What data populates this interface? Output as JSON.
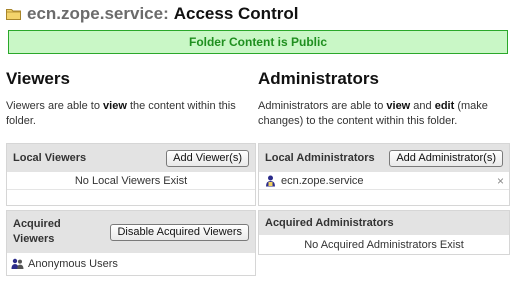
{
  "page": {
    "title_context": "ecn.zope.service:",
    "title_main": "Access Control",
    "status_banner": "Folder Content is Public"
  },
  "viewers": {
    "heading": "Viewers",
    "desc_pre": "Viewers are able to ",
    "desc_bold": "view",
    "desc_post": " the content within this folder.",
    "local_label": "Local Viewers",
    "add_button": "Add Viewer(s)",
    "local_empty": "No Local Viewers Exist",
    "acquired_label": "Acquired Viewers",
    "disable_button": "Disable Acquired Viewers",
    "acquired_items": [
      "Anonymous Users"
    ]
  },
  "administrators": {
    "heading": "Administrators",
    "desc_pre": "Administrators are able to ",
    "desc_bold1": "view",
    "desc_mid": " and ",
    "desc_bold2": "edit",
    "desc_post": " (make changes) to the content within this folder.",
    "local_label": "Local Administrators",
    "add_button": "Add Administrator(s)",
    "local_items": [
      "ecn.zope.service"
    ],
    "remove_glyph": "×",
    "acquired_label": "Acquired Administrators",
    "acquired_empty": "No Acquired Administrators Exist"
  },
  "icons": {
    "folder": "folder-icon",
    "user": "user-icon",
    "group": "group-icon",
    "remove": "close-icon"
  },
  "colors": {
    "banner_bg": "#c9f7c6",
    "banner_border": "#2aa82a",
    "banner_text": "#1f8f1f",
    "panel_header": "#e3e3e3"
  }
}
